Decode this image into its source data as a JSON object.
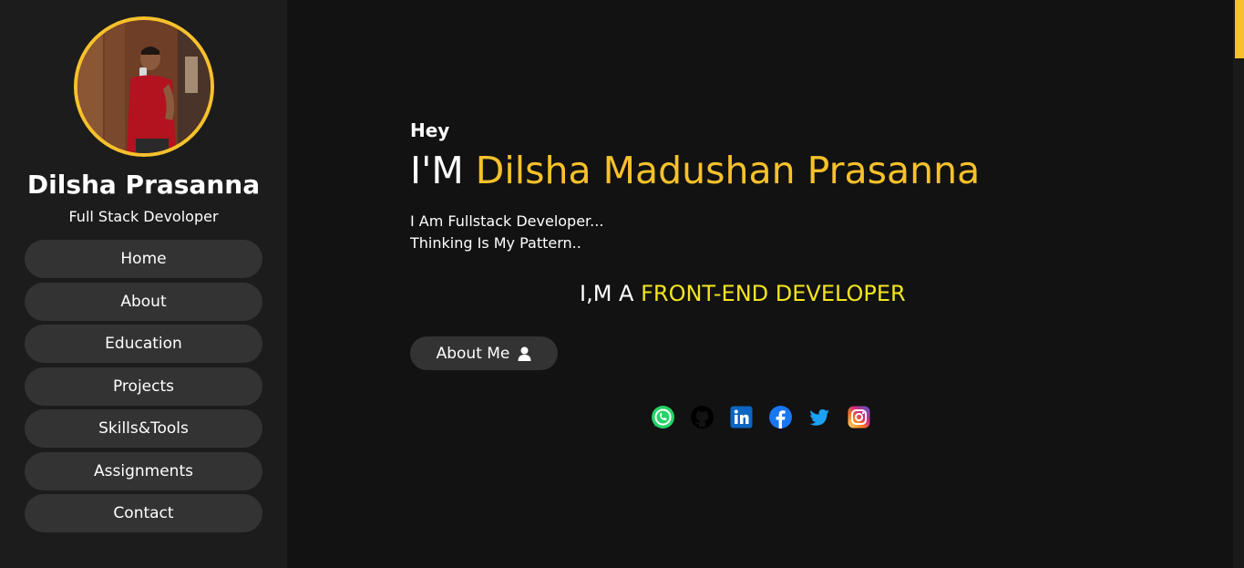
{
  "sidebar": {
    "name": "Dilsha Prasanna",
    "role": "Full Stack Devoloper",
    "items": [
      {
        "label": "Home"
      },
      {
        "label": "About"
      },
      {
        "label": "Education"
      },
      {
        "label": "Projects"
      },
      {
        "label": "Skills&Tools"
      },
      {
        "label": "Assignments"
      },
      {
        "label": "Contact"
      }
    ]
  },
  "hero": {
    "greeting": "Hey",
    "headline_prefix": "I'M",
    "headline_name": "Dilsha Madushan Prasanna",
    "tagline_1": "I Am Fullstack Developer...",
    "tagline_2": "Thinking Is My Pattern..",
    "role_prefix": "I,M A",
    "role": "FRONT-END DEVELOPER",
    "button_label": "About Me"
  },
  "social": [
    {
      "icon": "whatsapp-icon",
      "color": "#25d366"
    },
    {
      "icon": "github-icon",
      "color": "#000000"
    },
    {
      "icon": "linkedin-icon",
      "color": "#0a66c2"
    },
    {
      "icon": "facebook-icon",
      "color": "#1877f2"
    },
    {
      "icon": "twitter-icon",
      "color": "#1da1f2"
    },
    {
      "icon": "instagram-icon",
      "color": "#e1306c"
    }
  ],
  "colors": {
    "accent": "#f6c12b",
    "role_highlight": "#f3e520",
    "background": "#121212",
    "sidebar": "#1c1c1c",
    "button": "#333333"
  }
}
